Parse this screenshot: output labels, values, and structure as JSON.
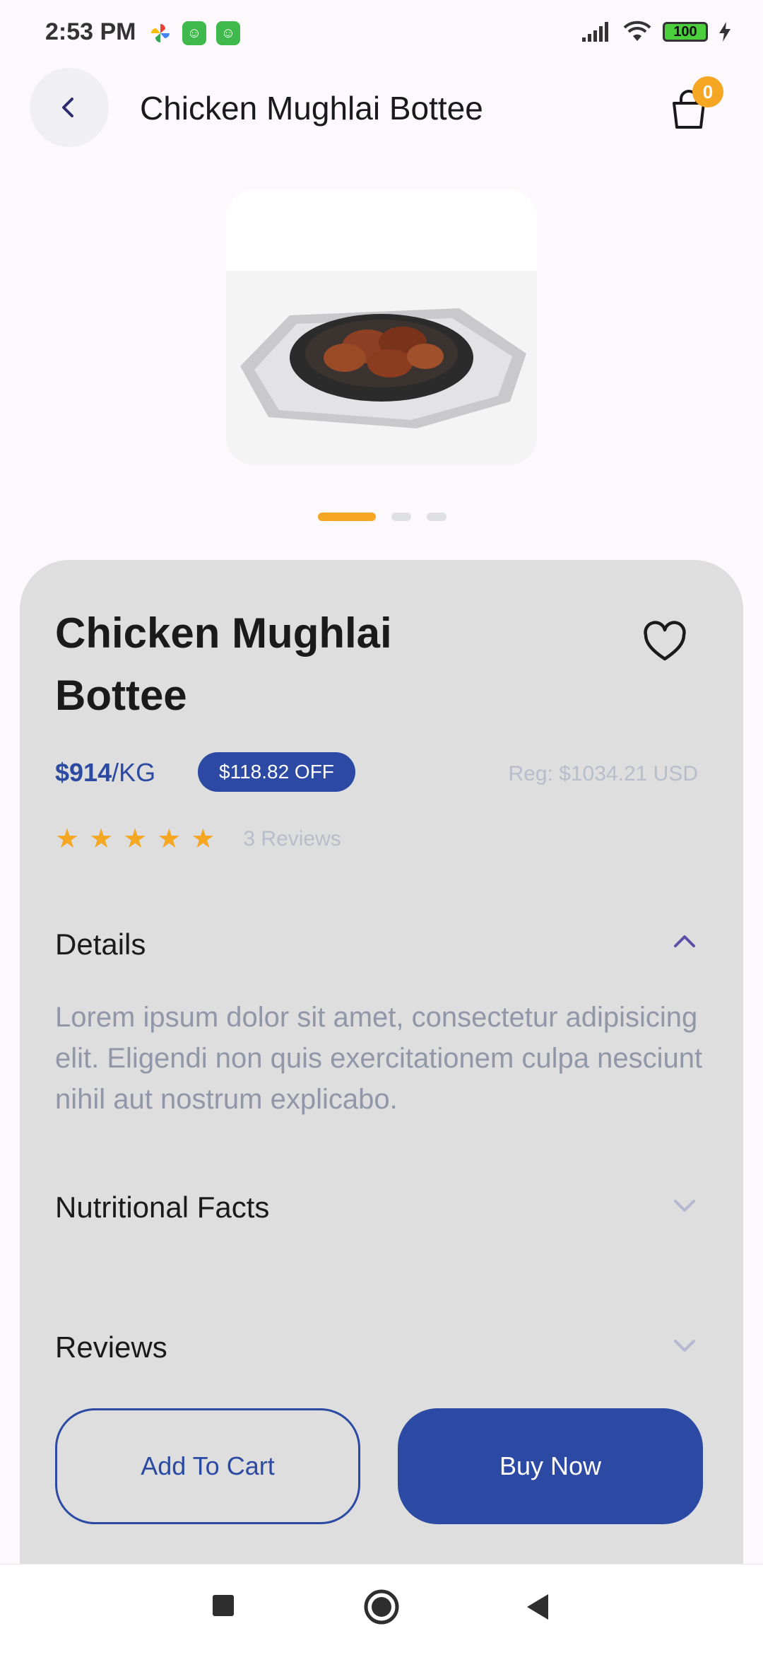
{
  "status_bar": {
    "time": "2:53 PM",
    "battery": "100"
  },
  "header": {
    "title": "Chicken Mughlai Bottee",
    "cart_count": "0"
  },
  "product": {
    "name": "Chicken Mughlai Bottee",
    "price": "$914",
    "unit": "/KG",
    "discount": "$118.82 OFF",
    "regular_price": "Reg: $1034.21 USD",
    "rating": 5,
    "reviews_label": "3 Reviews",
    "image_count": 3,
    "active_image": 1
  },
  "sections": {
    "details": {
      "title": "Details",
      "text": "Lorem ipsum dolor sit amet, consectetur adipisicing elit. Eligendi non quis exercitationem culpa nesciunt nihil aut nostrum explicabo.",
      "expanded": true
    },
    "nutrition": {
      "title": "Nutritional Facts",
      "expanded": false
    },
    "reviews": {
      "title": "Reviews",
      "expanded": false
    }
  },
  "actions": {
    "add_to_cart": "Add To Cart",
    "buy_now": "Buy Now"
  },
  "colors": {
    "primary": "#2c49a3",
    "accent": "#f5a623",
    "panel": "#dedede"
  }
}
